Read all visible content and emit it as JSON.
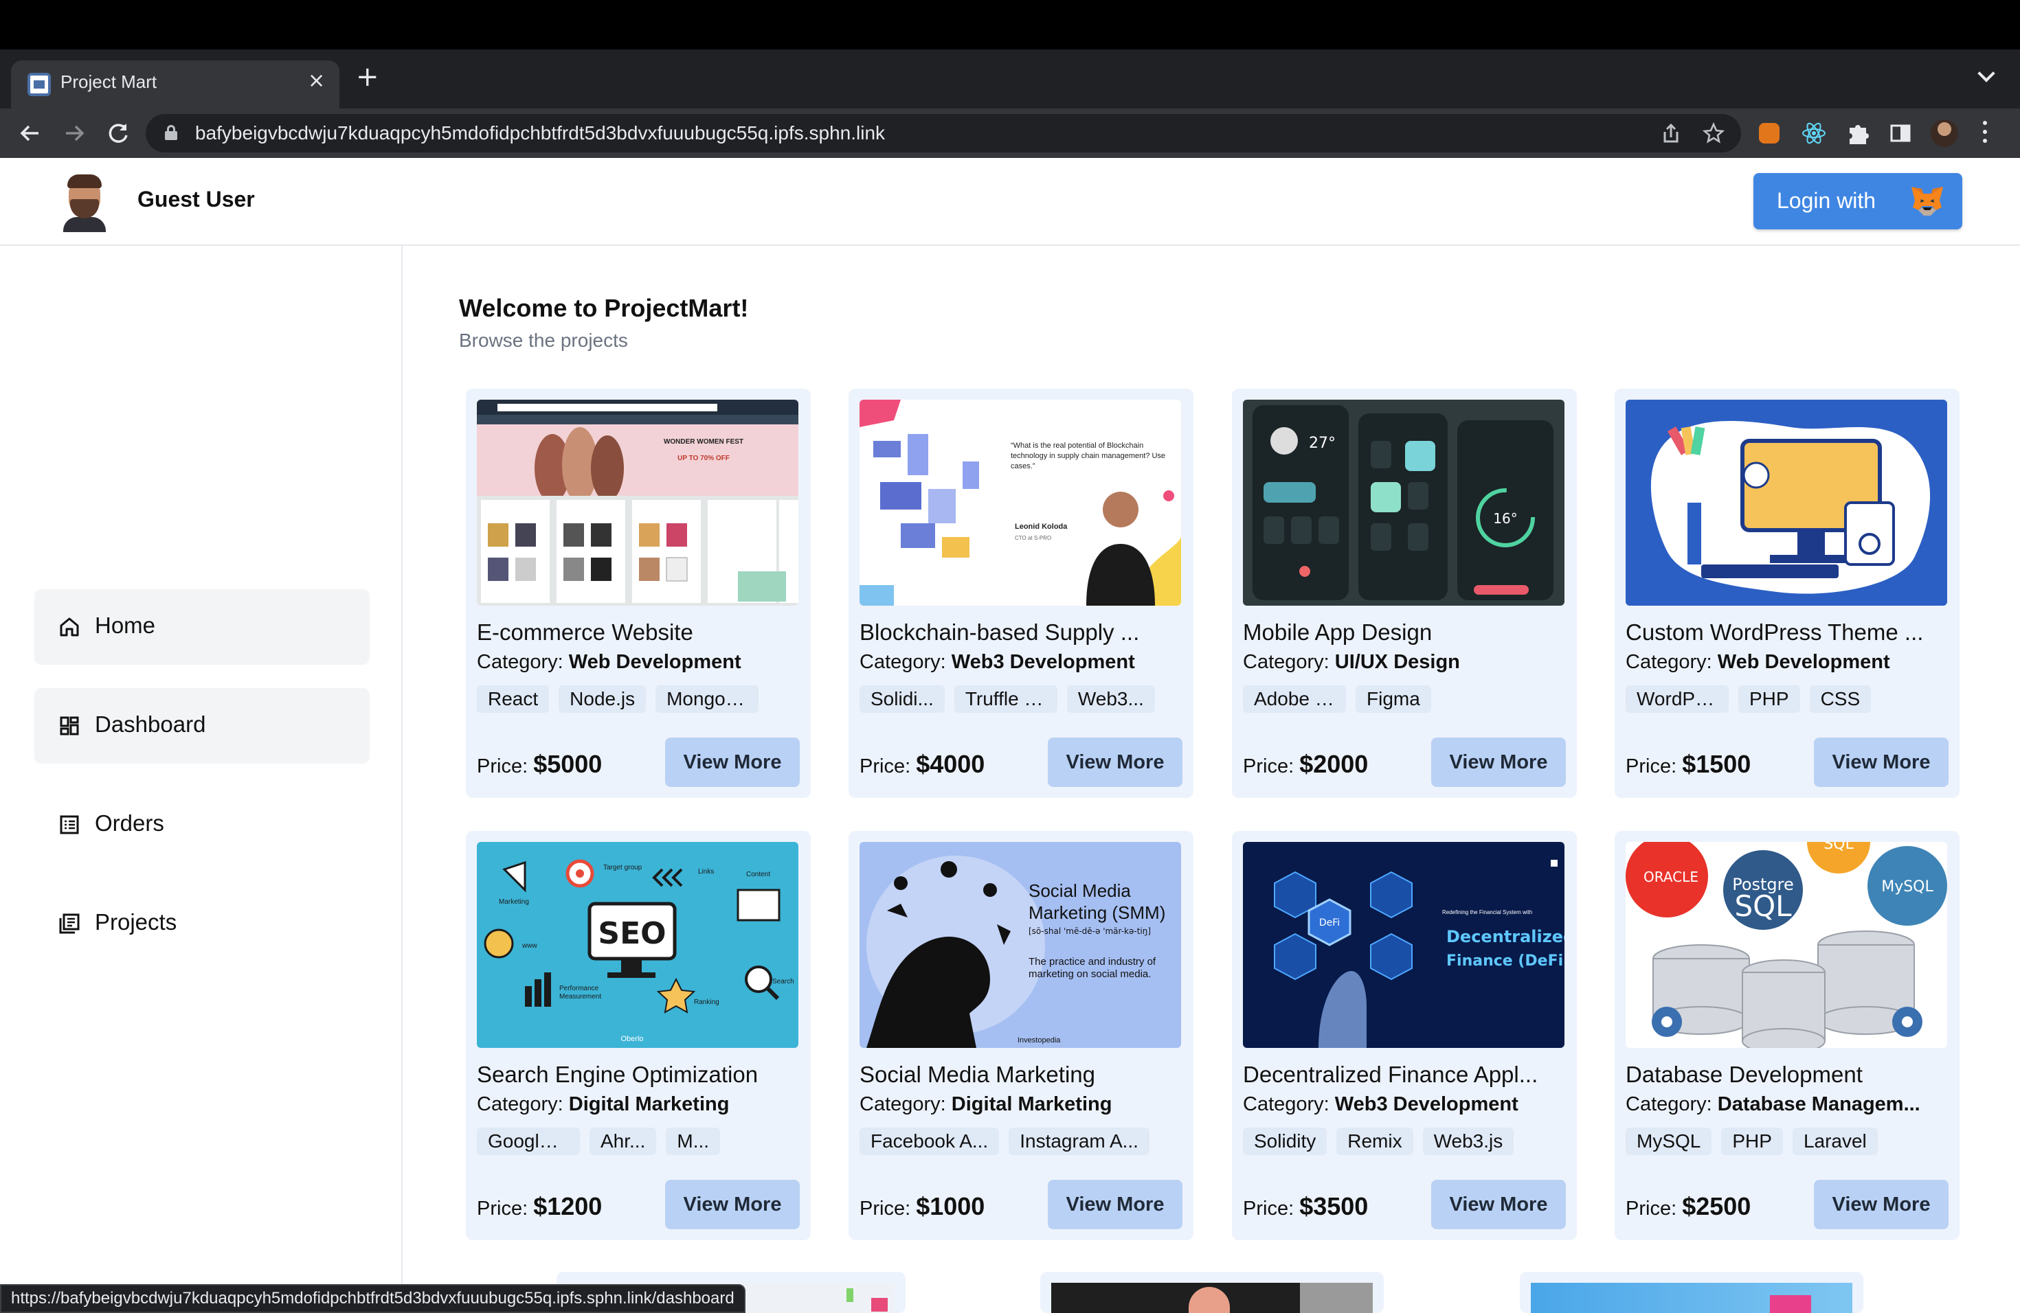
{
  "browser": {
    "tab_title": "Project Mart",
    "tab_close": "×",
    "new_tab": "+",
    "url": "bafybeigvbcdwju7kduaqpcyh5mdofidpchbtfrdt5d3bdvxfuuubugc55q.ipfs.sphn.link",
    "status_url": "https://bafybeigvbcdwju7kduaqpcyh5mdofidpchbtfrdt5d3bdvxfuuubugc55q.ipfs.sphn.link/dashboard"
  },
  "header": {
    "user_name": "Guest User",
    "login_label": "Login with",
    "login_icon": "metamask-fox-icon",
    "accent_color": "#3f86e2"
  },
  "sidebar": {
    "items": [
      {
        "label": "Home",
        "icon": "home-icon"
      },
      {
        "label": "Dashboard",
        "icon": "dashboard-icon"
      },
      {
        "label": "Orders",
        "icon": "orders-icon"
      },
      {
        "label": "Projects",
        "icon": "projects-icon"
      }
    ]
  },
  "main": {
    "welcome": "Welcome to ProjectMart!",
    "subtitle": "Browse the projects",
    "category_prefix": "Category:",
    "price_prefix": "Price:",
    "view_more": "View More",
    "projects": [
      {
        "title": "E-commerce Website",
        "category": "Web Development",
        "tags": [
          "React",
          "Node.js",
          "MongoDB"
        ],
        "price": "$5000"
      },
      {
        "title": "Blockchain-based Supply ...",
        "category": "Web3 Development",
        "tags": [
          "Solidi...",
          "Truffle Su...",
          "Web3..."
        ],
        "price": "$4000"
      },
      {
        "title": "Mobile App Design",
        "category": "UI/UX Design",
        "tags": [
          "Adobe XD",
          "Figma"
        ],
        "price": "$2000"
      },
      {
        "title": "Custom WordPress Theme ...",
        "category": "Web Development",
        "tags": [
          "WordPress",
          "PHP",
          "CSS"
        ],
        "price": "$1500"
      },
      {
        "title": "Search Engine Optimization",
        "category": "Digital Marketing",
        "tags": [
          "Google Analy...",
          "Ahr...",
          "M..."
        ],
        "price": "$1200"
      },
      {
        "title": "Social Media Marketing",
        "category": "Digital Marketing",
        "tags": [
          "Facebook A...",
          "Instagram A..."
        ],
        "price": "$1000"
      },
      {
        "title": "Decentralized Finance Appl...",
        "category": "Web3 Development",
        "tags": [
          "Solidity",
          "Remix",
          "Web3.js"
        ],
        "price": "$3500"
      },
      {
        "title": "Database Development",
        "category": "Database Managem...",
        "tags": [
          "MySQL",
          "PHP",
          "Laravel"
        ],
        "price": "$2500"
      }
    ]
  },
  "thumbs": {
    "ecom": {
      "banner": "WONDER WOMEN FEST",
      "sub": "UP TO 70% OFF"
    },
    "chain": {
      "quote": "“What is the real potential of Blockchain technology in supply chain management? Use cases.”",
      "name": "Leonid Koloda",
      "role": "CTO at S-PRO"
    },
    "mobile": {
      "temp1": "27°",
      "temp2": "16°"
    },
    "seo": {
      "label": "SEO",
      "marketing": "Marketing",
      "target": "Target group",
      "links": "Links",
      "content": "Content",
      "www": "www",
      "perf": "Performance Measurement",
      "ranking": "Ranking",
      "search": "Search",
      "brand": "Oberlo"
    },
    "smm": {
      "title": "Social Media Marketing (SMM)",
      "phon": "[sō-shal 'mē-dē-ə 'mär-kə-tiŋ]",
      "desc": "The practice and industry of marketing on social media.",
      "brand": "Investopedia"
    },
    "defi": {
      "kicker": "Redefining the Financial System with",
      "title1": "Decentralized",
      "title2": "Finance (DeFi)",
      "chip": "DeFi"
    },
    "db": {
      "oracle": "ORACLE",
      "postgres1": "Postgre",
      "postgres2": "SQL",
      "mysql": "MySQL",
      "sql": "SQL"
    }
  }
}
